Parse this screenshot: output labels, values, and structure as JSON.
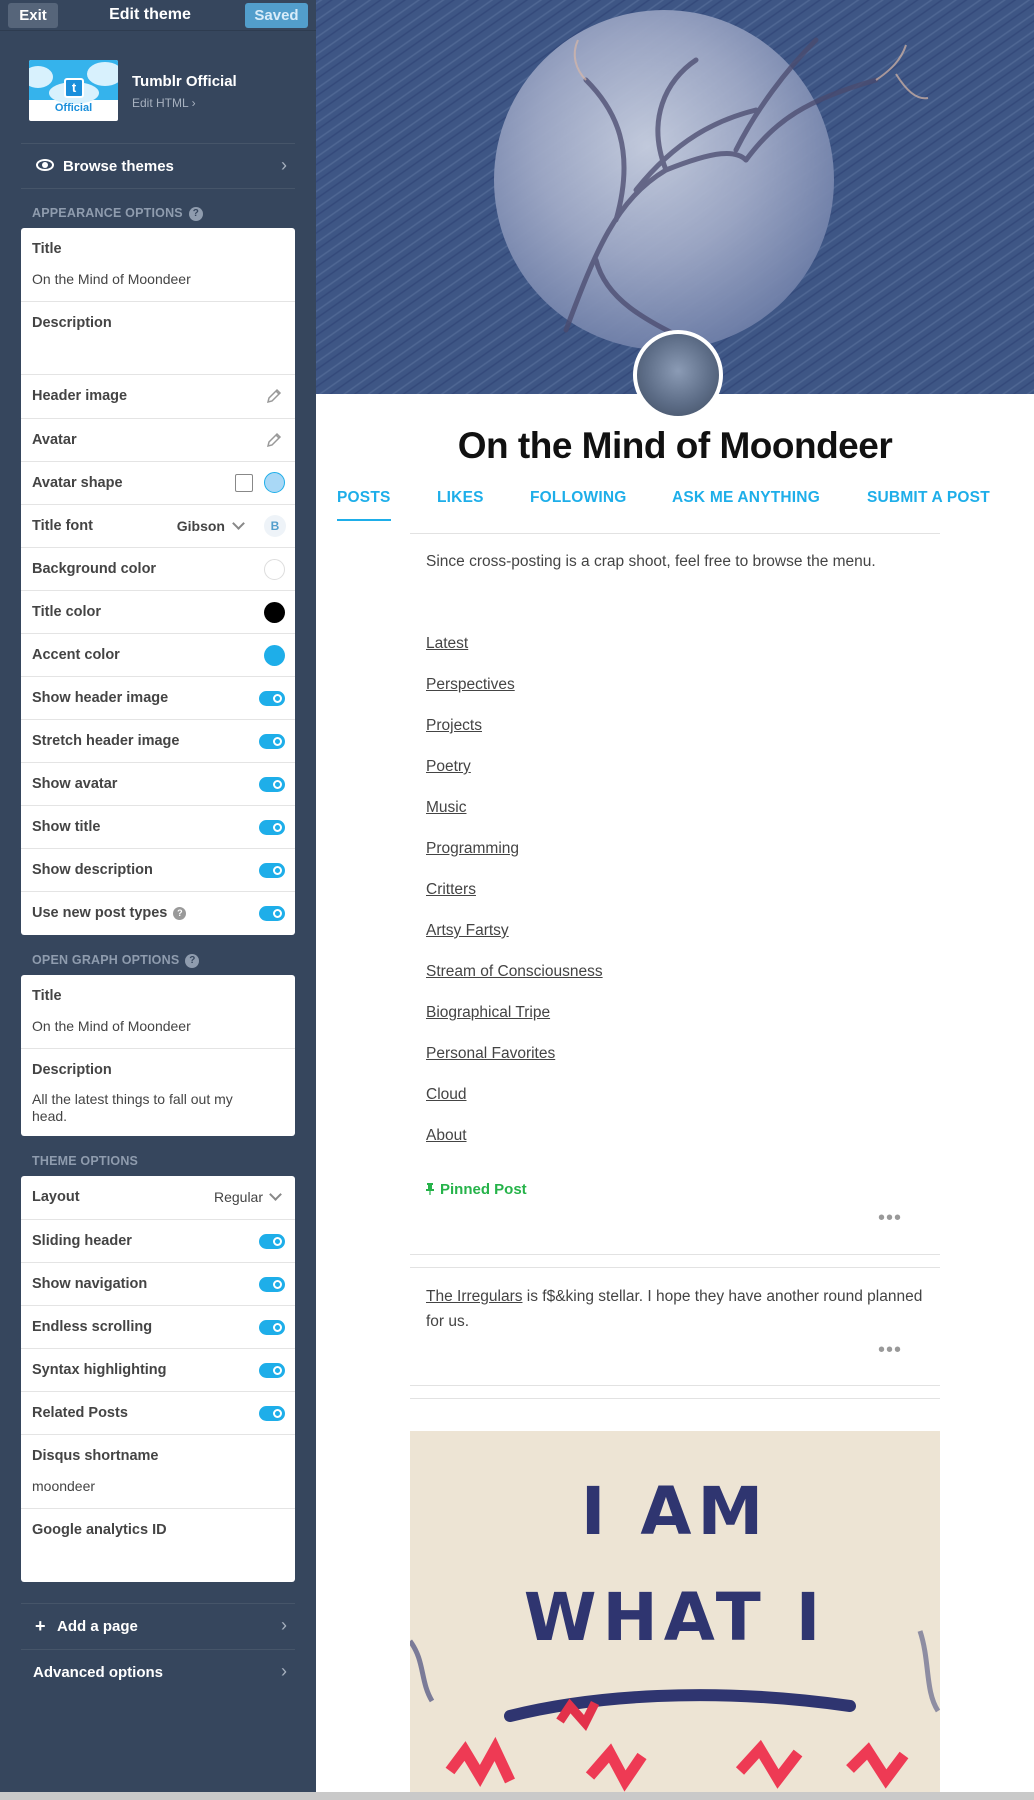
{
  "topbar": {
    "exit": "Exit",
    "title": "Edit theme",
    "saved": "Saved"
  },
  "theme": {
    "thumb_label": "Official",
    "thumb_logo": "t",
    "name": "Tumblr Official",
    "edit_html": "Edit HTML"
  },
  "browse": {
    "label": "Browse themes"
  },
  "appearance": {
    "heading": "APPEARANCE OPTIONS",
    "title_label": "Title",
    "title_value": "On the Mind of Moondeer",
    "description_label": "Description",
    "description_value": "",
    "header_image": "Header image",
    "avatar": "Avatar",
    "avatar_shape": "Avatar shape",
    "title_font": "Title font",
    "title_font_value": "Gibson",
    "bold_btn": "B",
    "background_color": "Background color",
    "title_color": "Title color",
    "accent_color": "Accent color",
    "show_header_image": "Show header image",
    "stretch_header_image": "Stretch header image",
    "show_avatar": "Show avatar",
    "show_title": "Show title",
    "show_description": "Show description",
    "use_new_post_types": "Use new post types",
    "colors": {
      "background": "#ffffff",
      "title": "#000000",
      "accent": "#1eaee9"
    }
  },
  "open_graph": {
    "heading": "OPEN GRAPH OPTIONS",
    "title_label": "Title",
    "title_value": "On the Mind of Moondeer",
    "description_label": "Description",
    "description_value": "All the latest things to fall out my head."
  },
  "theme_options": {
    "heading": "THEME OPTIONS",
    "layout": "Layout",
    "layout_value": "Regular",
    "sliding_header": "Sliding header",
    "show_navigation": "Show navigation",
    "endless_scrolling": "Endless scrolling",
    "syntax_highlighting": "Syntax highlighting",
    "related_posts": "Related Posts",
    "disqus_label": "Disqus shortname",
    "disqus_value": "moondeer",
    "google_label": "Google analytics ID",
    "google_value": ""
  },
  "footer": {
    "add_page": "Add a page",
    "advanced": "Advanced options"
  },
  "preview": {
    "blog_title": "On the Mind of Moondeer",
    "nav": [
      "POSTS",
      "LIKES",
      "FOLLOWING",
      "ASK ME ANYTHING",
      "SUBMIT A POST"
    ],
    "intro": "Since cross-posting is a crap shoot, feel free to browse the menu.",
    "links": [
      "Latest",
      "Perspectives",
      "Projects",
      "Poetry",
      "Music",
      "Programming",
      "Critters",
      "Artsy Fartsy",
      "Stream of Consciousness",
      "Biographical Tripe",
      "Personal Favorites",
      "Cloud",
      "About"
    ],
    "pinned": "Pinned Post",
    "post2_link": "The Irregulars",
    "post2_text": " is f$&king stellar. I hope they have another round planned for us.",
    "more": "•••",
    "image_text_line1": "I AM",
    "image_text_line2": "WHAT I"
  }
}
